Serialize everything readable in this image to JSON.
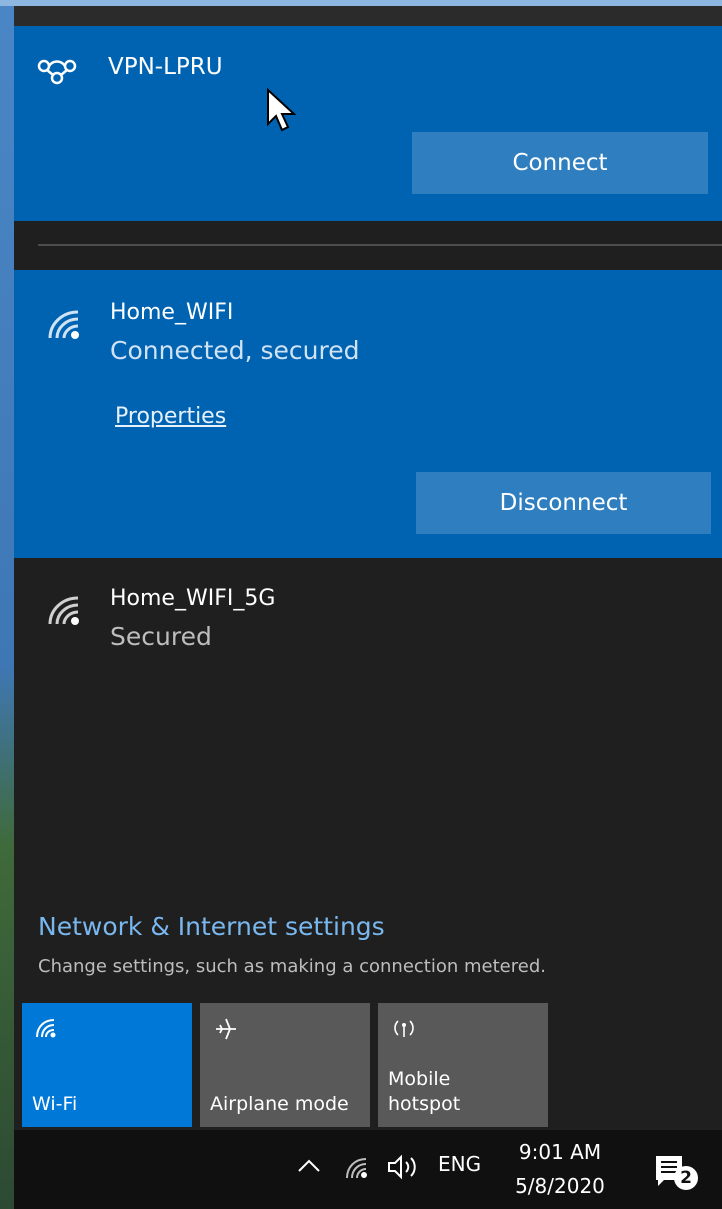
{
  "vpn": {
    "name": "VPN-LPRU",
    "connect_label": "Connect",
    "icon": "vpn-icon"
  },
  "networks": [
    {
      "name": "Home_WIFI",
      "status": "Connected, secured",
      "properties_label": "Properties",
      "action_label": "Disconnect",
      "icon": "wifi-icon"
    },
    {
      "name": "Home_WIFI_5G",
      "status": "Secured",
      "icon": "wifi-icon"
    }
  ],
  "settings": {
    "title": "Network & Internet settings",
    "subtitle": "Change settings, such as making a connection metered."
  },
  "quick_actions": [
    {
      "label": "Wi-Fi",
      "icon": "wifi-icon",
      "active": true
    },
    {
      "label": "Airplane mode",
      "icon": "airplane-icon",
      "active": false
    },
    {
      "label": "Mobile\nhotspot",
      "icon": "hotspot-icon",
      "active": false
    }
  ],
  "taskbar": {
    "language": "ENG",
    "time": "9:01 AM",
    "date": "5/8/2020",
    "notification_count": "2"
  },
  "colors": {
    "accent": "#0063b1",
    "active_tile": "#0078d7",
    "button": "#2f7fc0",
    "flyout_bg": "#1f1f1f",
    "link": "#79b7ee"
  }
}
